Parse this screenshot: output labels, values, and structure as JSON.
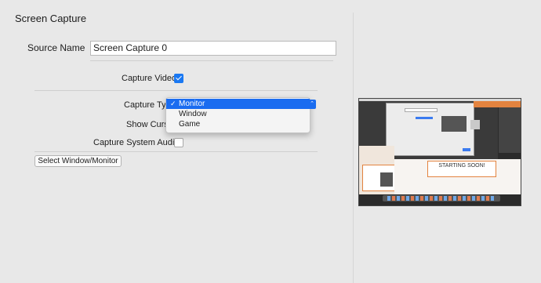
{
  "panel": {
    "title": "Screen Capture"
  },
  "source": {
    "label": "Source Name",
    "value": "Screen Capture 0"
  },
  "capture_video": {
    "label": "Capture Video",
    "checked": true
  },
  "capture_type": {
    "label": "Capture Type",
    "label_visible": "Capture Typ",
    "options": [
      "Monitor",
      "Window",
      "Game"
    ],
    "selected": "Monitor"
  },
  "show_cursor": {
    "label": "Show Cursor",
    "label_visible": "Show Curso"
  },
  "capture_audio": {
    "label": "Capture System Audio",
    "checked": false
  },
  "select_button": {
    "label": "Select Window/Monitor"
  },
  "preview": {
    "banner_text": "STARTING SOON!"
  },
  "colors": {
    "accent": "#1a6cf0",
    "background": "#e8e8e8",
    "banner": "#e3833f"
  }
}
